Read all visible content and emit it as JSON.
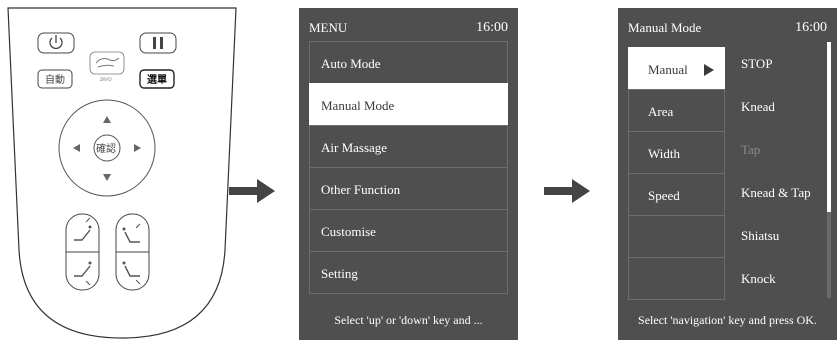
{
  "remote": {
    "buttons": {
      "power": "power-icon",
      "pause": "pause-icon",
      "zero_gravity_icon": "zero-gravity-icon",
      "zero_label": "zero",
      "auto_label": "自動",
      "menu_label": "選單",
      "confirm_label": "確認"
    }
  },
  "screen1": {
    "title": "MENU",
    "time": "16:00",
    "items": [
      {
        "label": "Auto Mode"
      },
      {
        "label": "Manual Mode"
      },
      {
        "label": "Air Massage"
      },
      {
        "label": "Other Function"
      },
      {
        "label": "Customise"
      },
      {
        "label": "Setting"
      }
    ],
    "selected_index": 1,
    "footer": "Select 'up' or 'down' key and ..."
  },
  "screen2": {
    "title": "Manual Mode",
    "time": "16:00",
    "left_items": [
      {
        "label": "Manual"
      },
      {
        "label": "Area"
      },
      {
        "label": "Width"
      },
      {
        "label": "Speed"
      },
      {
        "label": ""
      },
      {
        "label": ""
      }
    ],
    "right_items": [
      {
        "label": "STOP"
      },
      {
        "label": "Knead"
      },
      {
        "label": "Tap"
      },
      {
        "label": "Knead & Tap"
      },
      {
        "label": "Shiatsu"
      },
      {
        "label": "Knock"
      }
    ],
    "footer": "Select 'navigation' key and press OK."
  },
  "colors": {
    "screen_bg": "#4f4f4f",
    "selected_bg": "#ffffff",
    "disabled_text": "#8a8a8a"
  }
}
